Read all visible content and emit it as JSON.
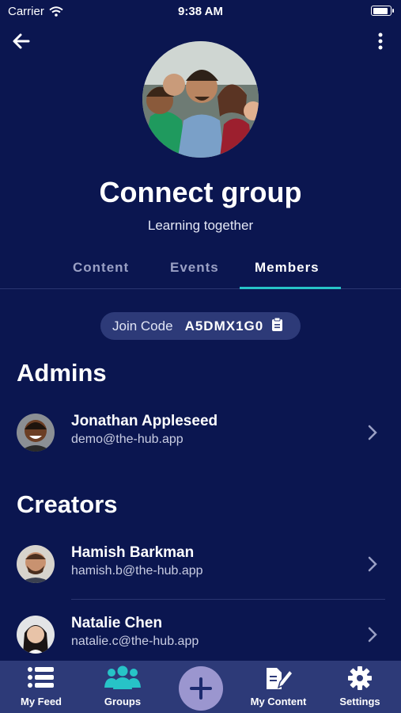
{
  "status_bar": {
    "carrier": "Carrier",
    "time": "9:38 AM",
    "battery_level": 1.0
  },
  "group": {
    "name": "Connect group",
    "subtitle": "Learning together"
  },
  "tabs": [
    {
      "label": "Content",
      "active": false
    },
    {
      "label": "Events",
      "active": false
    },
    {
      "label": "Members",
      "active": true
    }
  ],
  "join": {
    "label": "Join Code",
    "code": "A5DMX1G0"
  },
  "admins": {
    "title": "Admins",
    "members": [
      {
        "name": "Jonathan Appleseed",
        "email": "demo@the-hub.app"
      }
    ]
  },
  "creators": {
    "title": "Creators",
    "members": [
      {
        "name": "Hamish Barkman",
        "email": "hamish.b@the-hub.app"
      },
      {
        "name": "Natalie Chen",
        "email": "natalie.c@the-hub.app"
      }
    ]
  },
  "nav": [
    {
      "label": "My Feed",
      "icon": "list-icon"
    },
    {
      "label": "Groups",
      "icon": "people-icon",
      "active": true
    },
    {
      "label": "",
      "icon": "plus-icon"
    },
    {
      "label": "My Content",
      "icon": "edit-content-icon"
    },
    {
      "label": "Settings",
      "icon": "gear-icon"
    }
  ],
  "colors": {
    "background": "#0b1650",
    "accent": "#27c3c7",
    "panel": "#2d3a78",
    "add_button": "#9b96cf"
  }
}
